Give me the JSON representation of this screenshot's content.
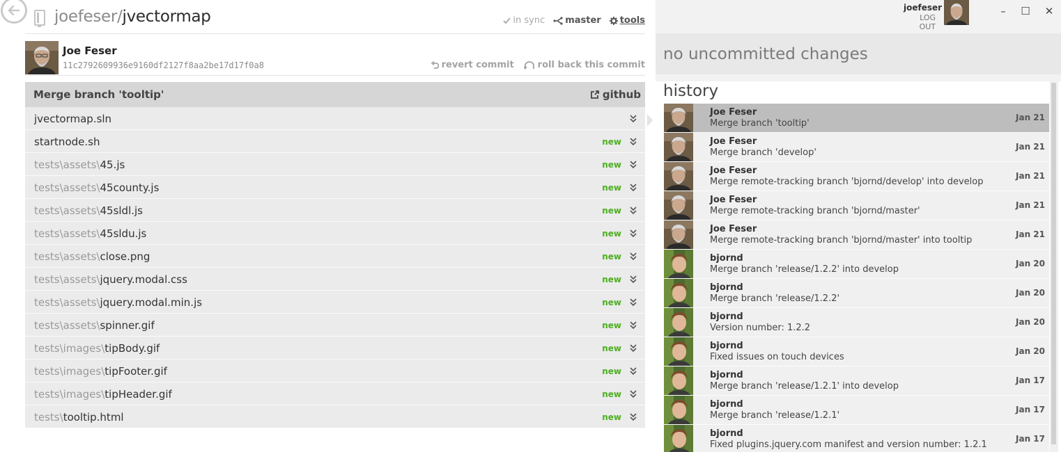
{
  "repo": {
    "owner": "joefeser",
    "separator": "/",
    "name": "jvectormap",
    "sync_label": "in sync",
    "branch_label": "master",
    "tools_label": "tools"
  },
  "commit": {
    "author": "Joe Feser",
    "sha": "11c2792609936e9160df2127f8aa2be17d17f0a8",
    "revert_label": "revert commit",
    "rollback_label": "roll back this commit",
    "message": "Merge branch 'tooltip'",
    "github_label": "github"
  },
  "files": [
    {
      "dir": "",
      "name": "jvectormap.sln",
      "badge": ""
    },
    {
      "dir": "",
      "name": "startnode.sh",
      "badge": "new"
    },
    {
      "dir": "tests\\assets\\",
      "name": "45.js",
      "badge": "new"
    },
    {
      "dir": "tests\\assets\\",
      "name": "45county.js",
      "badge": "new"
    },
    {
      "dir": "tests\\assets\\",
      "name": "45sldl.js",
      "badge": "new"
    },
    {
      "dir": "tests\\assets\\",
      "name": "45sldu.js",
      "badge": "new"
    },
    {
      "dir": "tests\\assets\\",
      "name": "close.png",
      "badge": "new"
    },
    {
      "dir": "tests\\assets\\",
      "name": "jquery.modal.css",
      "badge": "new"
    },
    {
      "dir": "tests\\assets\\",
      "name": "jquery.modal.min.js",
      "badge": "new"
    },
    {
      "dir": "tests\\assets\\",
      "name": "spinner.gif",
      "badge": "new"
    },
    {
      "dir": "tests\\images\\",
      "name": "tipBody.gif",
      "badge": "new"
    },
    {
      "dir": "tests\\images\\",
      "name": "tipFooter.gif",
      "badge": "new"
    },
    {
      "dir": "tests\\images\\",
      "name": "tipHeader.gif",
      "badge": "new"
    },
    {
      "dir": "tests\\",
      "name": "tooltip.html",
      "badge": "new"
    }
  ],
  "user": {
    "username": "joefeser",
    "logout_label": "LOG OUT"
  },
  "window": {
    "minimize": "–",
    "maximize": "☐",
    "close": "✕"
  },
  "changes": {
    "status": "no uncommitted changes"
  },
  "history": {
    "title": "history",
    "items": [
      {
        "author": "Joe Feser",
        "message": "Merge branch 'tooltip'",
        "date": "Jan 21",
        "avatar": "joe",
        "selected": true
      },
      {
        "author": "Joe Feser",
        "message": "Merge branch 'develop'",
        "date": "Jan 21",
        "avatar": "joe"
      },
      {
        "author": "Joe Feser",
        "message": "Merge remote-tracking branch 'bjornd/develop' into develop",
        "date": "Jan 21",
        "avatar": "joe"
      },
      {
        "author": "Joe Feser",
        "message": "Merge remote-tracking branch 'bjornd/master'",
        "date": "Jan 21",
        "avatar": "joe"
      },
      {
        "author": "Joe Feser",
        "message": "Merge remote-tracking branch 'bjornd/master' into tooltip",
        "date": "Jan 21",
        "avatar": "joe"
      },
      {
        "author": "bjornd",
        "message": "Merge branch 'release/1.2.2' into develop",
        "date": "Jan 20",
        "avatar": "bjornd"
      },
      {
        "author": "bjornd",
        "message": "Merge branch 'release/1.2.2'",
        "date": "Jan 20",
        "avatar": "bjornd"
      },
      {
        "author": "bjornd",
        "message": "Version number: 1.2.2",
        "date": "Jan 20",
        "avatar": "bjornd"
      },
      {
        "author": "bjornd",
        "message": "Fixed issues on touch devices",
        "date": "Jan 20",
        "avatar": "bjornd"
      },
      {
        "author": "bjornd",
        "message": "Merge branch 'release/1.2.1' into develop",
        "date": "Jan 17",
        "avatar": "bjornd"
      },
      {
        "author": "bjornd",
        "message": "Merge branch 'release/1.2.1'",
        "date": "Jan 17",
        "avatar": "bjornd"
      },
      {
        "author": "bjornd",
        "message": "Fixed plugins.jquery.com manifest and version number: 1.2.1",
        "date": "Jan 17",
        "avatar": "bjornd"
      }
    ]
  },
  "colors": {
    "new_badge": "#4caf1f",
    "selected_row": "#bdbdbd",
    "row_bg": "#f0f0f0",
    "file_row_bg": "#ebebeb",
    "commit_bar": "#d6d6d6"
  }
}
